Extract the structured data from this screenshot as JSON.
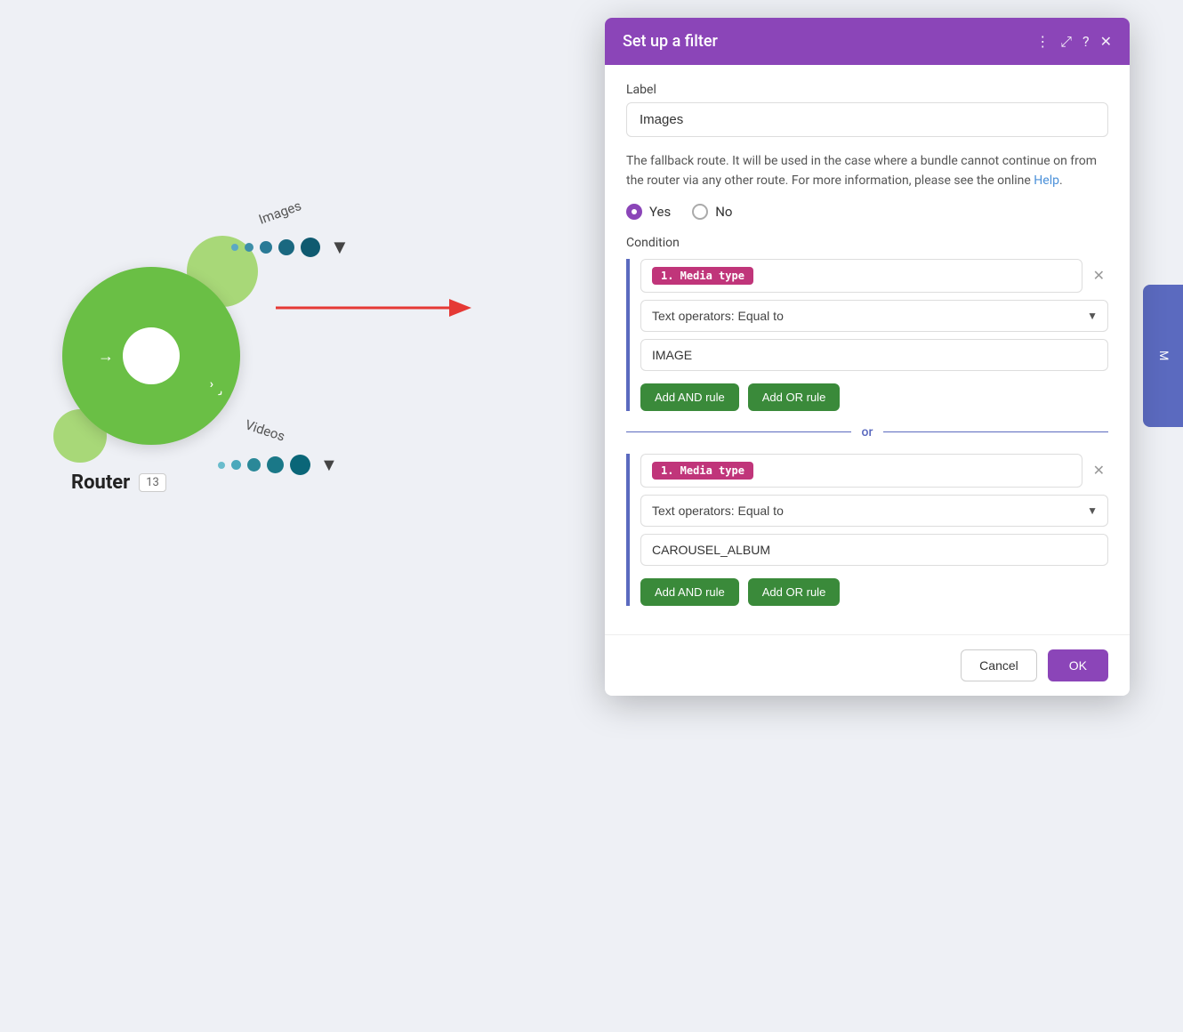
{
  "canvas": {
    "background_color": "#eef0f5"
  },
  "router": {
    "label": "Router",
    "count": "13",
    "paths": [
      {
        "name": "Images",
        "type": "image"
      },
      {
        "name": "Videos",
        "type": "video"
      }
    ]
  },
  "modal": {
    "title": "Set up a filter",
    "label_field": {
      "label": "Label",
      "value": "Images"
    },
    "description": "The fallback route. It will be used in the case where a bundle cannot continue on from the router via any other route. For more information, please see the online",
    "help_link_text": "Help",
    "fallback": {
      "yes_label": "Yes",
      "no_label": "No",
      "selected": "yes"
    },
    "condition_label": "Condition",
    "condition_blocks": [
      {
        "tag": "1. Media type",
        "operator": "Text operators: Equal to",
        "value": "IMAGE",
        "add_and_label": "Add AND rule",
        "add_or_label": "Add OR rule"
      },
      {
        "tag": "1. Media type",
        "operator": "Text operators: Equal to",
        "value": "CAROUSEL_ALBUM",
        "add_and_label": "Add AND rule",
        "add_or_label": "Add OR rule"
      }
    ],
    "or_separator": "or",
    "footer": {
      "cancel_label": "Cancel",
      "ok_label": "OK"
    }
  },
  "header_icons": {
    "more_icon": "⋮",
    "expand_icon": "⤢",
    "help_icon": "?",
    "close_icon": "✕"
  }
}
